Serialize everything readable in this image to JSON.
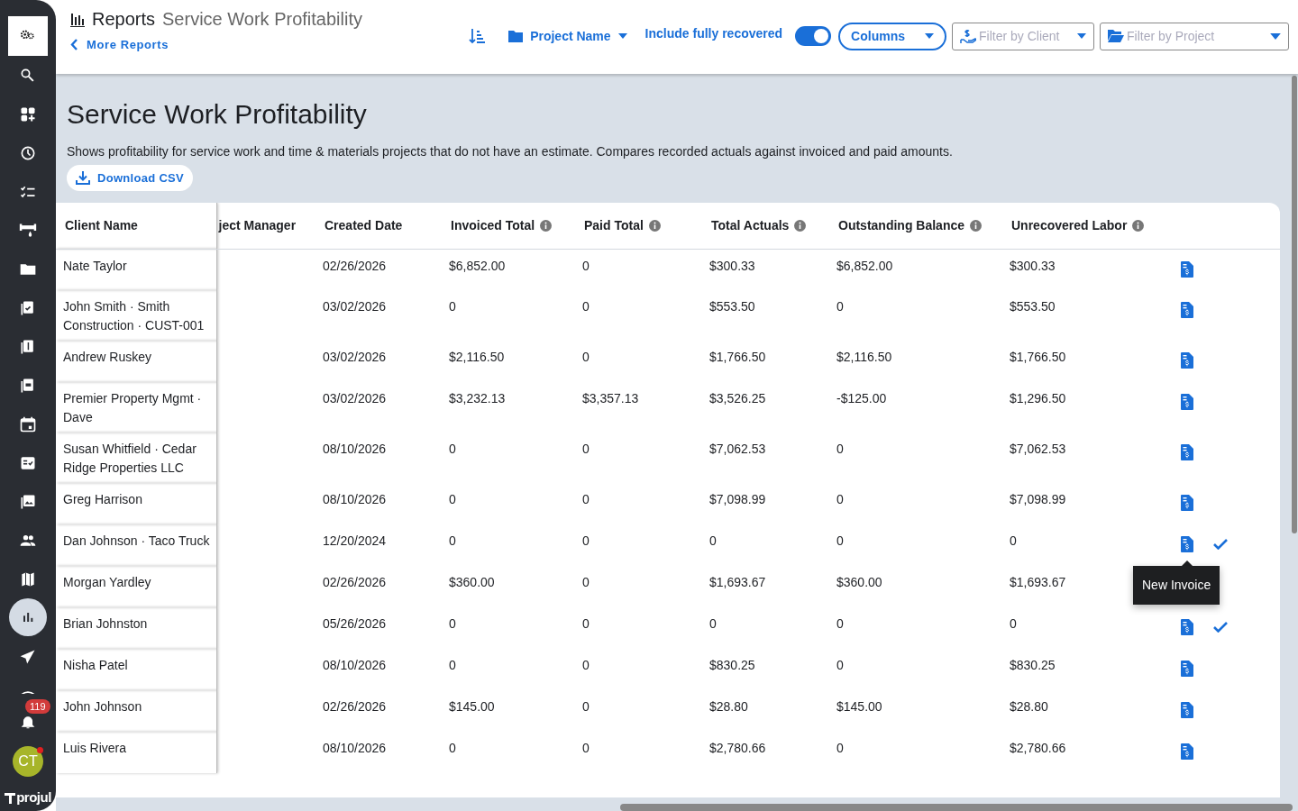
{
  "sidebar": {
    "items": [
      {
        "selected": true
      },
      {
        "selected": false
      },
      {
        "selected": false
      },
      {
        "selected": false
      },
      {
        "selected": false
      },
      {
        "selected": false
      },
      {
        "selected": false
      },
      {
        "selected": false
      },
      {
        "selected": false
      },
      {
        "selected": false
      },
      {
        "selected": false
      },
      {
        "selected": false
      },
      {
        "selected": false
      },
      {
        "selected": false
      },
      {
        "selected": false
      },
      {
        "selected": true
      },
      {
        "selected": false
      },
      {
        "selected": false
      }
    ],
    "notifications_badge": "119",
    "avatar": {
      "initials": "CT",
      "online_dot": true
    },
    "brand": "projul"
  },
  "header": {
    "section": "Reports",
    "title": "Service Work Profitability",
    "back_link": "More Reports",
    "group_by": "Project Name",
    "include_recovered": {
      "label": "Include fully recovered",
      "on": true
    },
    "columns_button": "Columns",
    "client_filter": {
      "placeholder": "Filter by Client"
    },
    "project_filter": {
      "placeholder": "Filter by Project"
    }
  },
  "report": {
    "title": "Service Work Profitability",
    "description": "Shows profitability for service work and time & materials projects that do not have an estimate. Compares recorded actuals against invoiced and paid amounts.",
    "download_button": "Download CSV"
  },
  "table": {
    "columns": [
      {
        "label": "Client Name",
        "info": false
      },
      {
        "label": "ject Manager",
        "info": false
      },
      {
        "label": "Created Date",
        "info": false
      },
      {
        "label": "Invoiced Total",
        "info": true
      },
      {
        "label": "Paid Total",
        "info": true
      },
      {
        "label": "Total Actuals",
        "info": true
      },
      {
        "label": "Outstanding Balance",
        "info": true
      },
      {
        "label": "Unrecovered Labor",
        "info": true
      }
    ],
    "rows": [
      {
        "cells": [
          "Nate Taylor",
          "",
          "02/26/2026",
          "$6,852.00",
          "0",
          "$300.33",
          "$6,852.00",
          "$300.33"
        ],
        "recovered": false
      },
      {
        "cells": [
          "John Smith · Smith Construction · CUST-001",
          "",
          "03/02/2026",
          "0",
          "0",
          "$553.50",
          "0",
          "$553.50"
        ],
        "recovered": false
      },
      {
        "cells": [
          "Andrew Ruskey",
          "",
          "03/02/2026",
          "$2,116.50",
          "0",
          "$1,766.50",
          "$2,116.50",
          "$1,766.50"
        ],
        "recovered": false
      },
      {
        "cells": [
          "Premier Property Mgmt · Dave",
          "",
          "03/02/2026",
          "$3,232.13",
          "$3,357.13",
          "$3,526.25",
          "-$125.00",
          "$1,296.50"
        ],
        "recovered": false
      },
      {
        "cells": [
          "Susan Whitfield · Cedar Ridge Properties LLC",
          "",
          "08/10/2026",
          "0",
          "0",
          "$7,062.53",
          "0",
          "$7,062.53"
        ],
        "recovered": false
      },
      {
        "cells": [
          "Greg Harrison",
          "",
          "08/10/2026",
          "0",
          "0",
          "$7,098.99",
          "0",
          "$7,098.99"
        ],
        "recovered": false
      },
      {
        "cells": [
          "Dan Johnson · Taco Truck",
          "",
          "12/20/2024",
          "0",
          "0",
          "0",
          "0",
          "0"
        ],
        "recovered": true,
        "tooltip": "New Invoice"
      },
      {
        "cells": [
          "Morgan Yardley",
          "",
          "02/26/2026",
          "$360.00",
          "0",
          "$1,693.67",
          "$360.00",
          "$1,693.67"
        ],
        "recovered": false
      },
      {
        "cells": [
          "Brian Johnston",
          "",
          "05/26/2026",
          "0",
          "0",
          "0",
          "0",
          "0"
        ],
        "recovered": true
      },
      {
        "cells": [
          "Nisha Patel",
          "",
          "08/10/2026",
          "0",
          "0",
          "$830.25",
          "0",
          "$830.25"
        ],
        "recovered": false
      },
      {
        "cells": [
          "John Johnson",
          "",
          "02/26/2026",
          "$145.00",
          "0",
          "$28.80",
          "$145.00",
          "$28.80"
        ],
        "recovered": false
      },
      {
        "cells": [
          "Luis Rivera",
          "",
          "08/10/2026",
          "0",
          "0",
          "$2,780.66",
          "0",
          "$2,780.66"
        ],
        "recovered": false
      }
    ]
  }
}
